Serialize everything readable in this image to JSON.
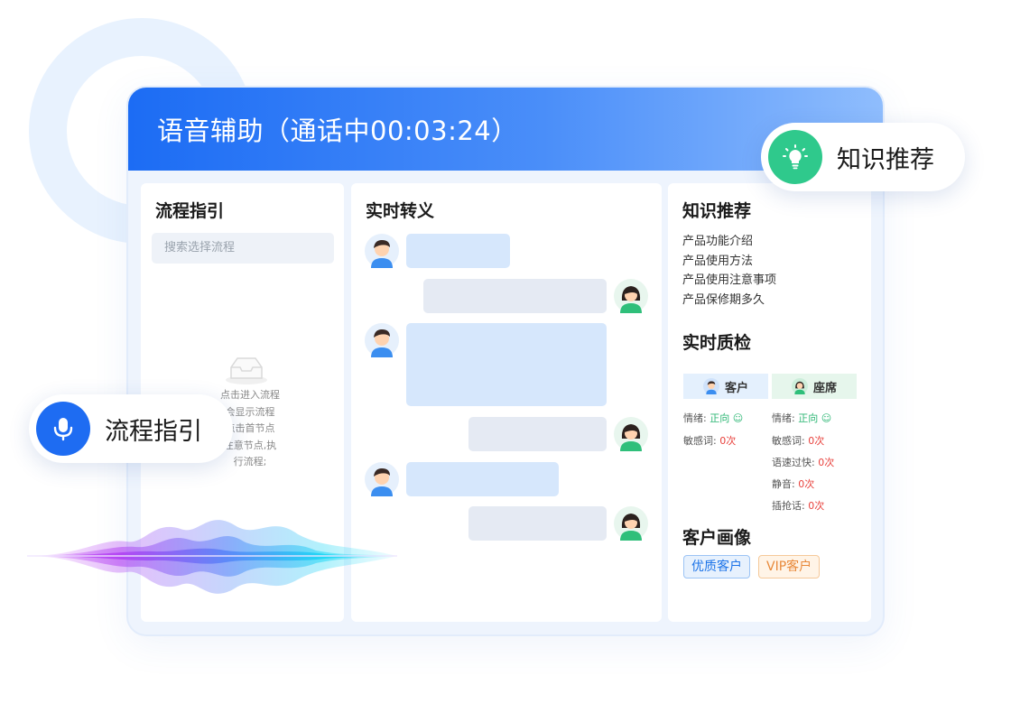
{
  "window": {
    "title": "语音辅助（通话中00:03:24）"
  },
  "flow_panel": {
    "title": "流程指引",
    "search_placeholder": "搜索选择流程",
    "empty_lines": [
      "点击进入流程",
      "会显示流程",
      "点击首节点",
      "注意节点,执",
      "行流程;"
    ]
  },
  "transcript_panel": {
    "title": "实时转义",
    "messages": [
      {
        "speaker": "customer"
      },
      {
        "speaker": "agent"
      },
      {
        "speaker": "customer"
      },
      {
        "speaker": "agent"
      },
      {
        "speaker": "customer"
      },
      {
        "speaker": "agent"
      }
    ]
  },
  "right_panel": {
    "knowledge": {
      "title": "知识推荐",
      "items": [
        "产品功能介绍",
        "产品使用方法",
        "产品使用注意事项",
        "产品保修期多久"
      ]
    },
    "quality": {
      "title": "实时质检",
      "customer": {
        "label": "客户",
        "emotion_label": "情绪:",
        "emotion_value": "正向",
        "sensitive_label": "敏感词:",
        "sensitive_value": "0次"
      },
      "agent": {
        "label": "座席",
        "emotion_label": "情绪:",
        "emotion_value": "正向",
        "sensitive_label": "敏感词:",
        "sensitive_value": "0次",
        "speed_label": "语速过快:",
        "speed_value": "0次",
        "silence_label": "静音:",
        "silence_value": "0次",
        "interrupt_label": "插抢话:",
        "interrupt_value": "0次"
      }
    },
    "profile": {
      "title": "客户画像",
      "tags": [
        "优质客户",
        "VIP客户"
      ]
    }
  },
  "badges": {
    "knowledge": {
      "label": "知识推荐",
      "icon": "lightbulb-icon",
      "color": "#2fc98c"
    },
    "flow": {
      "label": "流程指引",
      "icon": "microphone-icon",
      "color": "#1e6cf2"
    }
  },
  "colors": {
    "header_start": "#1c6cf4",
    "header_end": "#8fbdfd",
    "positive": "#2bb673",
    "count": "#e8413c"
  }
}
